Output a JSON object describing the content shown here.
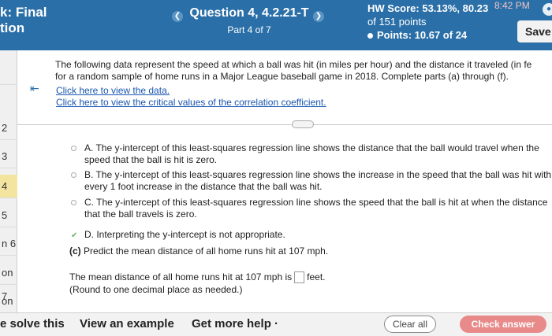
{
  "header": {
    "title_line1": "k: Final",
    "title_line2": "tion",
    "question_title": "Question 4, 4.2.21-T",
    "part": "Part 4 of 7",
    "hw_score": "HW Score: 53.13%, 80.23",
    "of_points": "of 151 points",
    "points": "Points: 10.67 of 24",
    "clock": "8:42 PM",
    "save_label": "Save",
    "prev_icon": "chevron-left",
    "next_icon": "chevron-right"
  },
  "sidebar": {
    "items": [
      {
        "label": ""
      },
      {
        "label": "2"
      },
      {
        "label": "3"
      },
      {
        "label": "4"
      },
      {
        "label": "5"
      },
      {
        "label": "n 6"
      },
      {
        "label": "on 7"
      },
      {
        "label": "on 8"
      }
    ]
  },
  "main": {
    "prompt_line1": "The following data represent the speed at which a ball was hit (in miles per hour) and the distance it traveled (in fe",
    "prompt_line2": "for a random sample of home runs in a Major League baseball game in 2018. Complete parts (a) through (f).",
    "link_data": "Click here to view the data.",
    "link_critical": "Click here to view the critical values of the correlation coefficient.",
    "options": [
      {
        "letter": "A.",
        "line1": "The y-intercept of this least-squares regression line shows the distance that the ball would travel when the",
        "line2": "speed that the ball is hit is zero.",
        "selected": false
      },
      {
        "letter": "B.",
        "line1": "The y-intercept of this least-squares regression line shows the increase in the speed that the ball was hit with",
        "line2": "every 1 foot increase in the distance that the ball was hit.",
        "selected": false
      },
      {
        "letter": "C.",
        "line1": "The y-intercept of this least-squares regression line shows the speed that the ball is hit at when the distance",
        "line2": "that the ball travels is zero.",
        "selected": false
      },
      {
        "letter": "D.",
        "line1": "Interpreting the y-intercept is not appropriate.",
        "line2": "",
        "selected": true
      }
    ],
    "part_c_label": "(c)",
    "part_c_text": "Predict the mean distance of all home runs hit at 107 mph.",
    "answer_prefix": "The mean distance of all home runs hit at 107 mph is",
    "answer_unit": "feet.",
    "answer_hint": "(Round to one decimal place as needed.)"
  },
  "footer": {
    "solve": "e solve this",
    "example": "View an example",
    "help": "Get more help ·",
    "clear": "Clear all",
    "check": "Check answer"
  }
}
